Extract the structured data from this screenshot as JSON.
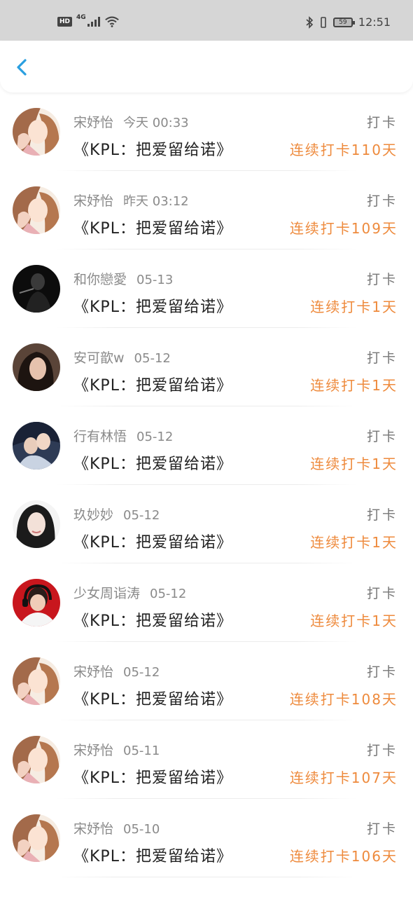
{
  "status_bar": {
    "hd": "HD",
    "network": "4G",
    "battery": "59",
    "time": "12:51",
    "icons": [
      "signal-icon",
      "wifi-icon",
      "bluetooth-icon",
      "vibrate-icon",
      "battery-icon"
    ]
  },
  "header": {
    "back_icon": "chevron-left-icon",
    "accent_color": "#2a9fe0"
  },
  "colors": {
    "streak": "#ee8a3c",
    "name": "#8a8a8a",
    "title": "#222222"
  },
  "items": [
    {
      "name": "宋妤怡",
      "time": "今天 00:33",
      "title": "《KPL：把爱留给诺》",
      "action": "打卡",
      "streak": "连续打卡110天",
      "avatar": "anime-girl-avatar"
    },
    {
      "name": "宋妤怡",
      "time": "昨天 03:12",
      "title": "《KPL：把爱留给诺》",
      "action": "打卡",
      "streak": "连续打卡109天",
      "avatar": "anime-girl-avatar"
    },
    {
      "name": "和你戀愛",
      "time": "05-13",
      "title": "《KPL：把爱留给诺》",
      "action": "打卡",
      "streak": "连续打卡1天",
      "avatar": "dark-photo-avatar"
    },
    {
      "name": "安可歆w",
      "time": "05-12",
      "title": "《KPL：把爱留给诺》",
      "action": "打卡",
      "streak": "连续打卡1天",
      "avatar": "girl-photo-avatar"
    },
    {
      "name": "行有林悟",
      "time": "05-12",
      "title": "《KPL：把爱留给诺》",
      "action": "打卡",
      "streak": "连续打卡1天",
      "avatar": "couple-photo-avatar"
    },
    {
      "name": "玖妙妙",
      "time": "05-12",
      "title": "《KPL：把爱留给诺》",
      "action": "打卡",
      "streak": "连续打卡1天",
      "avatar": "girl-portrait-avatar"
    },
    {
      "name": "少女周诣涛",
      "time": "05-12",
      "title": "《KPL：把爱留给诺》",
      "action": "打卡",
      "streak": "连续打卡1天",
      "avatar": "headset-player-avatar"
    },
    {
      "name": "宋妤怡",
      "time": "05-12",
      "title": "《KPL：把爱留给诺》",
      "action": "打卡",
      "streak": "连续打卡108天",
      "avatar": "anime-girl-avatar"
    },
    {
      "name": "宋妤怡",
      "time": "05-11",
      "title": "《KPL：把爱留给诺》",
      "action": "打卡",
      "streak": "连续打卡107天",
      "avatar": "anime-girl-avatar"
    },
    {
      "name": "宋妤怡",
      "time": "05-10",
      "title": "《KPL：把爱留给诺》",
      "action": "打卡",
      "streak": "连续打卡106天",
      "avatar": "anime-girl-avatar"
    }
  ]
}
